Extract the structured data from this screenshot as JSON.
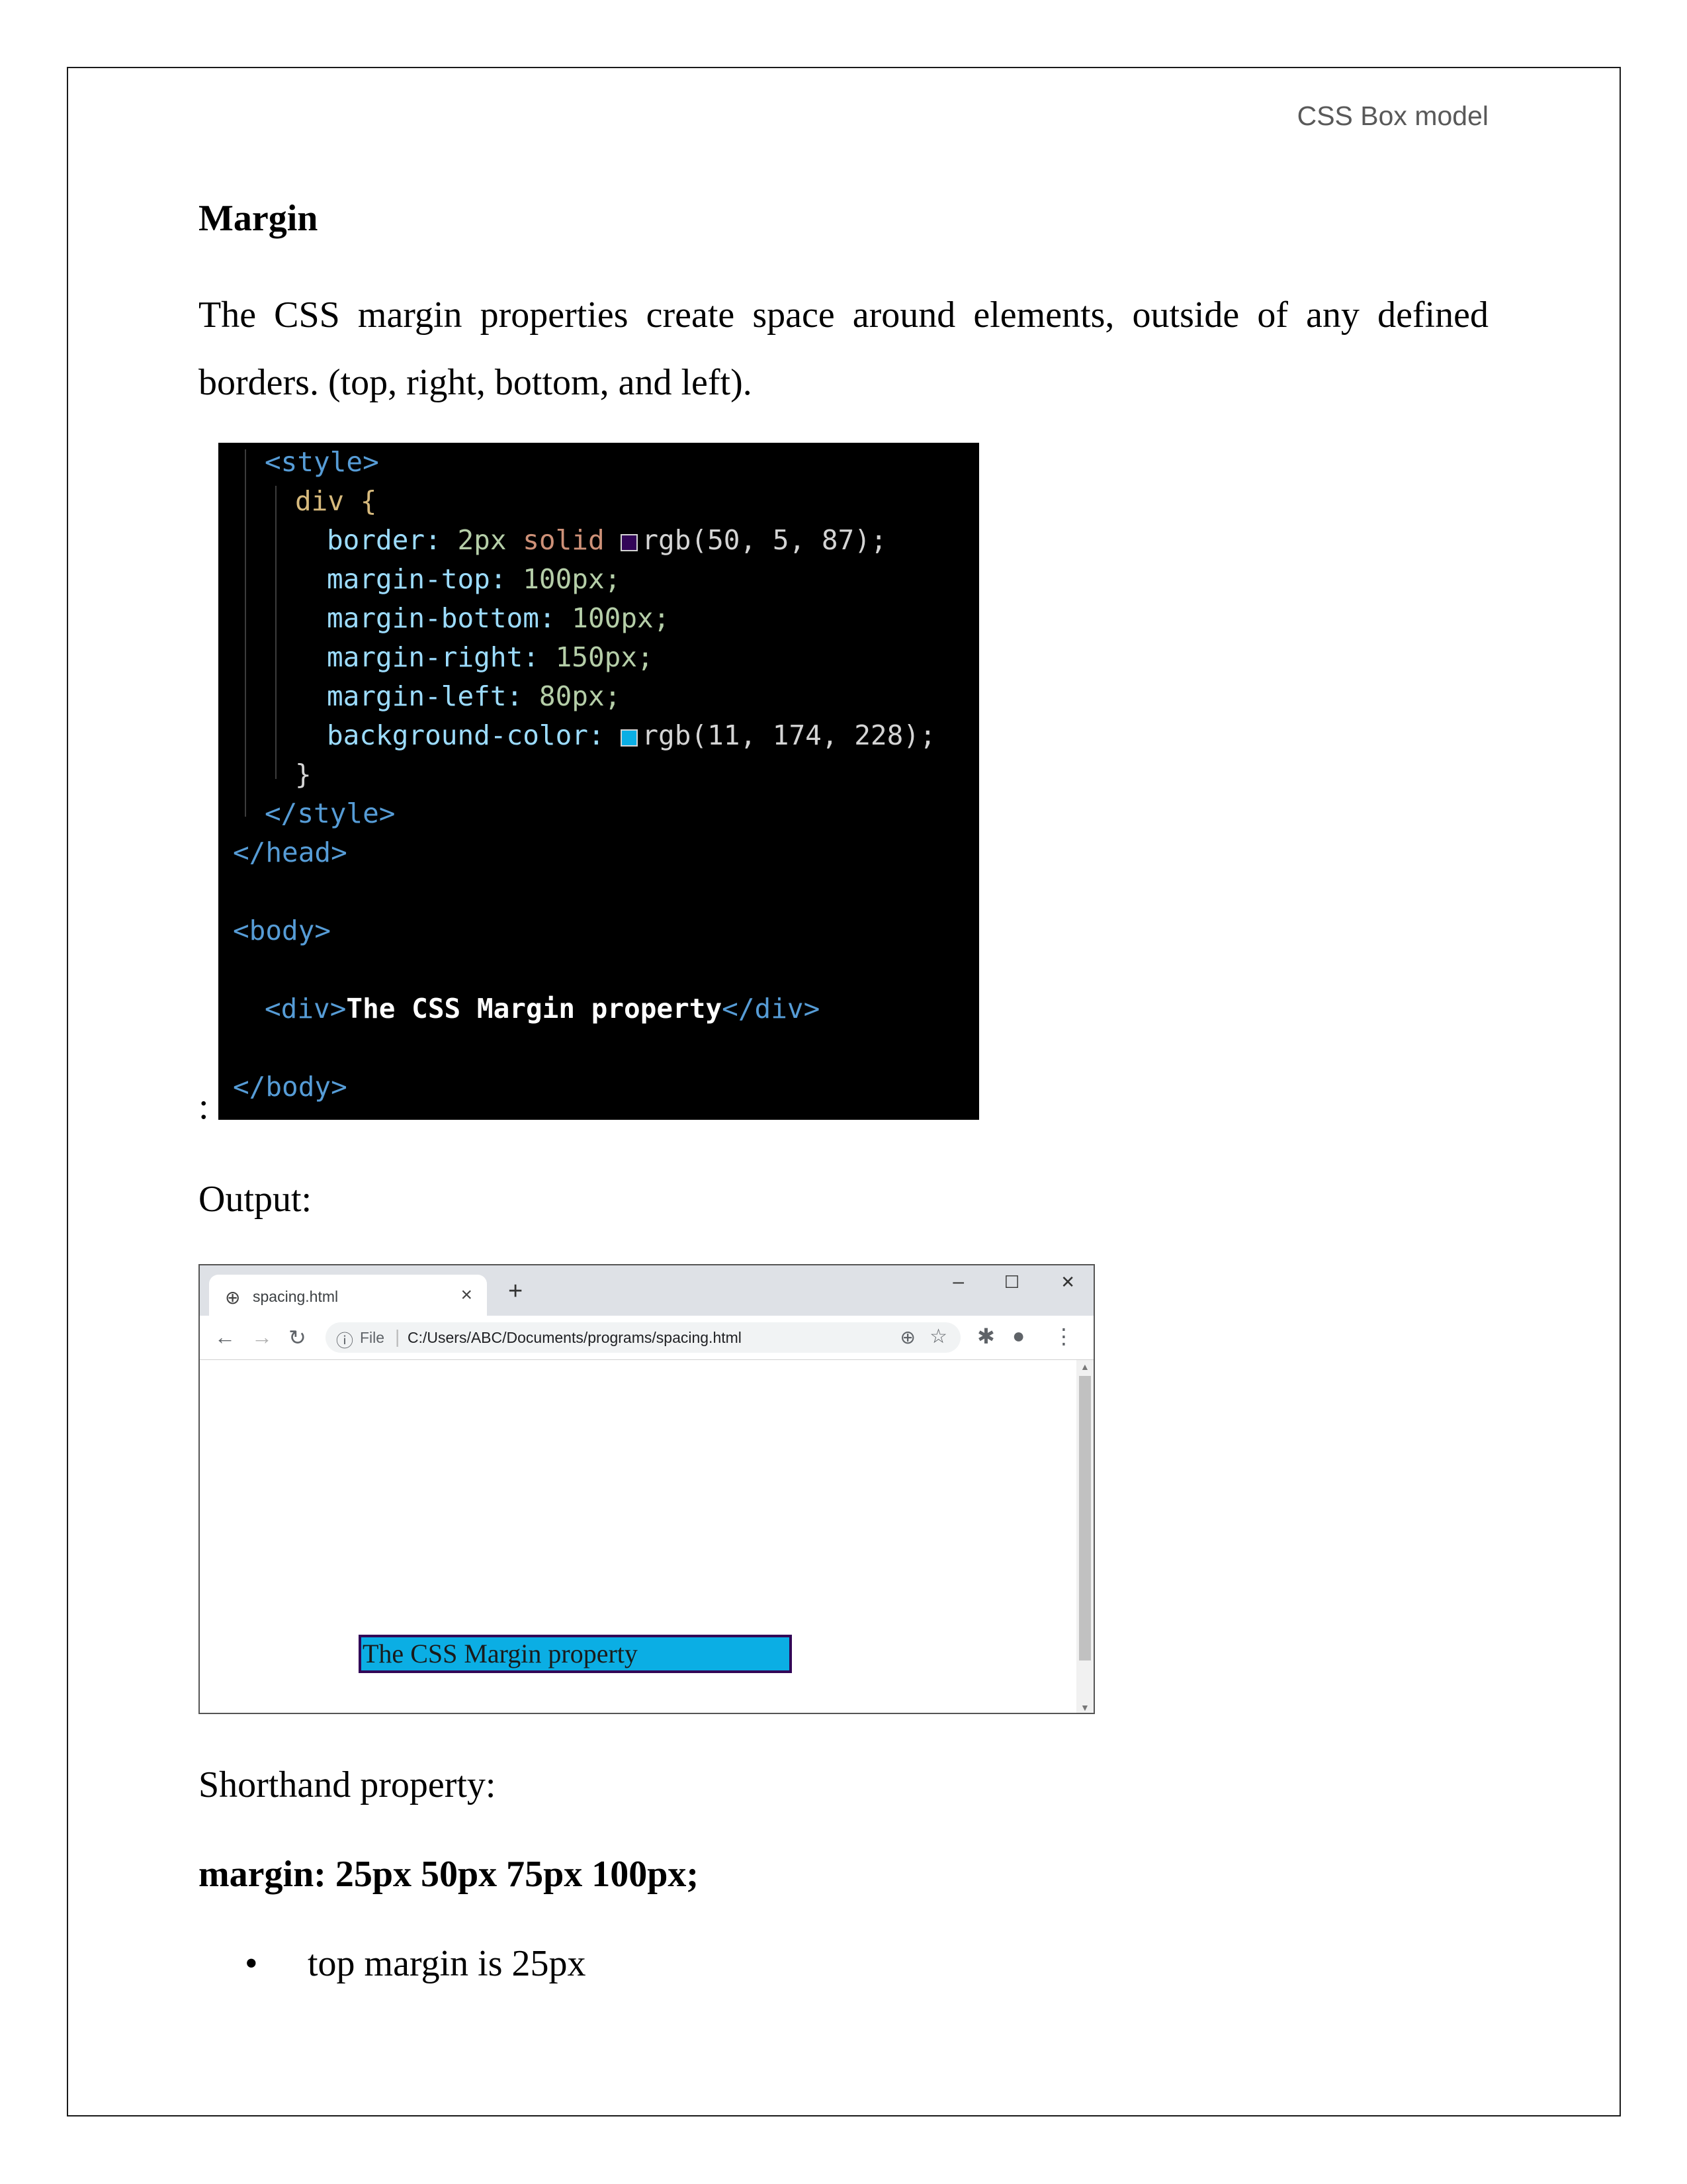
{
  "header": {
    "text": "CSS Box model"
  },
  "heading": "Margin",
  "paragraph": "The CSS margin properties create space around elements, outside of any defined borders. (top, right, bottom, and left).",
  "colon": ":",
  "code": {
    "style_open": "<style>",
    "selector": "div {",
    "border_prop": "border:",
    "border_width": "2px",
    "border_style": "solid",
    "border_color": "rgb(50, 5, 87);",
    "margin_top_prop": "margin-top:",
    "margin_top_val": "100px;",
    "margin_bottom_prop": "margin-bottom:",
    "margin_bottom_val": "100px;",
    "margin_right_prop": "margin-right:",
    "margin_right_val": "150px;",
    "margin_left_prop": "margin-left:",
    "margin_left_val": "80px;",
    "bg_prop": "background-color:",
    "bg_val": "rgb(11, 174, 228);",
    "close_brace": "}",
    "style_close": "</style>",
    "head_close": "</head>",
    "body_open": "<body>",
    "div_open": "<div>",
    "div_text": "The CSS Margin property",
    "div_close": "</div>",
    "body_close": "</body>",
    "swatch_border_color": "#320557",
    "swatch_bg_color": "#0baee4"
  },
  "output_label": "Output:",
  "browser": {
    "tab_title": "spacing.html",
    "tab_close": "×",
    "new_tab": "+",
    "minimize": "–",
    "maximize": "☐",
    "close": "✕",
    "file_label": "File",
    "url": "C:/Users/ABC/Documents/programs/spacing.html",
    "demo_text": "The CSS Margin property",
    "icons": [
      "globe-icon",
      "back-icon",
      "forward-icon",
      "reload-icon",
      "info-icon",
      "zoom-icon",
      "star-icon",
      "extensions-icon",
      "profile-icon",
      "menu-icon"
    ]
  },
  "shorthand_label": "Shorthand property:",
  "shorthand_code": "margin: 25px 50px 75px 100px;",
  "bullets": [
    "top margin is 25px"
  ]
}
